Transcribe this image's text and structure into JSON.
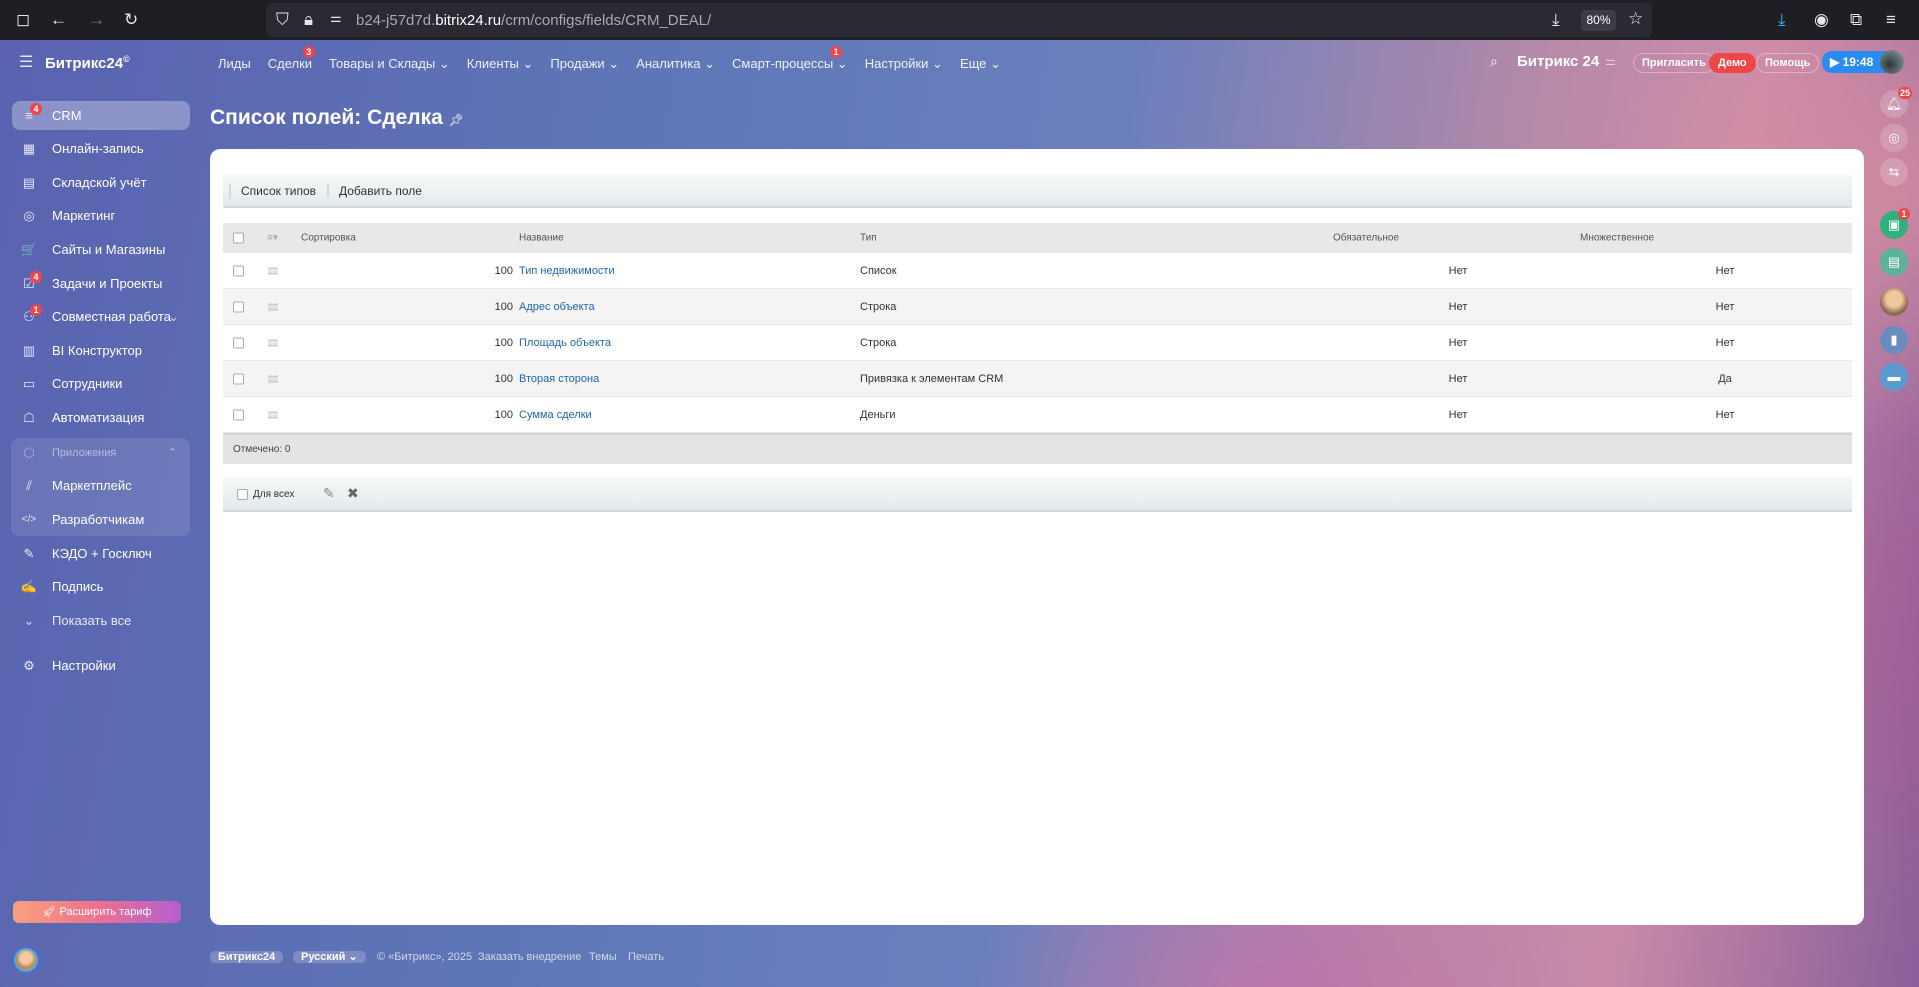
{
  "browser": {
    "url_prefix": "b24-j57d7d.",
    "url_domain": "bitrix24.ru",
    "url_path": "/crm/configs/fields/CRM_DEAL/",
    "zoom": "80%"
  },
  "header": {
    "logo": "Битрикс24",
    "logo_mark": "©",
    "nav": [
      {
        "label": "Лиды"
      },
      {
        "label": "Сделки",
        "badge": "3"
      },
      {
        "label": "Товары и Склады ⌄"
      },
      {
        "label": "Клиенты ⌄"
      },
      {
        "label": "Продажи ⌄"
      },
      {
        "label": "Аналитика ⌄"
      },
      {
        "label": "Смарт-процессы ⌄",
        "badge": "1"
      },
      {
        "label": "Настройки ⌄"
      },
      {
        "label": "Еще ⌄"
      }
    ],
    "brand": "Битрикс 24",
    "invite": "Пригласить",
    "demo": "Демо",
    "help": "Помощь",
    "time": "19:48"
  },
  "sidebar": {
    "items": [
      {
        "label": "CRM",
        "badge": "4",
        "icon": "≡"
      },
      {
        "label": "Онлайн-запись",
        "icon": "▦"
      },
      {
        "label": "Складской учёт",
        "icon": "▤"
      },
      {
        "label": "Маркетинг",
        "icon": "◎"
      },
      {
        "label": "Сайты и Магазины",
        "icon": "🛒"
      },
      {
        "label": "Задачи и Проекты",
        "badge": "4",
        "icon": "☑"
      },
      {
        "label": "Совместная работа",
        "badge": "1",
        "icon": "⚇"
      },
      {
        "label": "BI Конструктор",
        "icon": "▥"
      },
      {
        "label": "Сотрудники",
        "icon": "▭"
      },
      {
        "label": "Автоматизация",
        "icon": "☖"
      }
    ],
    "apps_group": "Приложения",
    "apps": [
      {
        "label": "Маркетплейс",
        "icon": "⫽"
      },
      {
        "label": "Разработчикам",
        "icon": "</>"
      }
    ],
    "more": [
      {
        "label": "КЭДО + Госключ",
        "icon": "✎"
      },
      {
        "label": "Подпись",
        "icon": "✍"
      },
      {
        "label": "Показать все",
        "icon": "⌄"
      },
      {
        "label": "Настройки",
        "icon": "⚙"
      }
    ],
    "upgrade": "Расширить тариф"
  },
  "page": {
    "title": "Список полей: Сделка"
  },
  "toolbar": {
    "types": "Список типов",
    "add": "Добавить поле"
  },
  "table": {
    "headers": {
      "sort": "Сортировка",
      "name": "Название",
      "type": "Тип",
      "required": "Обязательное",
      "multiple": "Множественное"
    },
    "rows": [
      {
        "sort": "100",
        "name": "Тип недвижимости",
        "type": "Список",
        "required": "Нет",
        "multiple": "Нет"
      },
      {
        "sort": "100",
        "name": "Адрес объекта",
        "type": "Строка",
        "required": "Нет",
        "multiple": "Нет"
      },
      {
        "sort": "100",
        "name": "Площадь объекта",
        "type": "Строка",
        "required": "Нет",
        "multiple": "Нет"
      },
      {
        "sort": "100",
        "name": "Вторая сторона",
        "type": "Привязка к элементам CRM",
        "required": "Нет",
        "multiple": "Да"
      },
      {
        "sort": "100",
        "name": "Сумма сделки",
        "type": "Деньги",
        "required": "Нет",
        "multiple": "Нет"
      }
    ],
    "selected": "Отмечено: 0",
    "for_all": "Для всех"
  },
  "right_panel": {
    "notifications_badge": "25",
    "contacts_badge": "1"
  },
  "footer": {
    "brand": "Битрикс24",
    "lang": "Русский",
    "copyright": "© «Битрикс», 2025",
    "order": "Заказать внедрение",
    "themes": "Темы",
    "print": "Печать"
  }
}
